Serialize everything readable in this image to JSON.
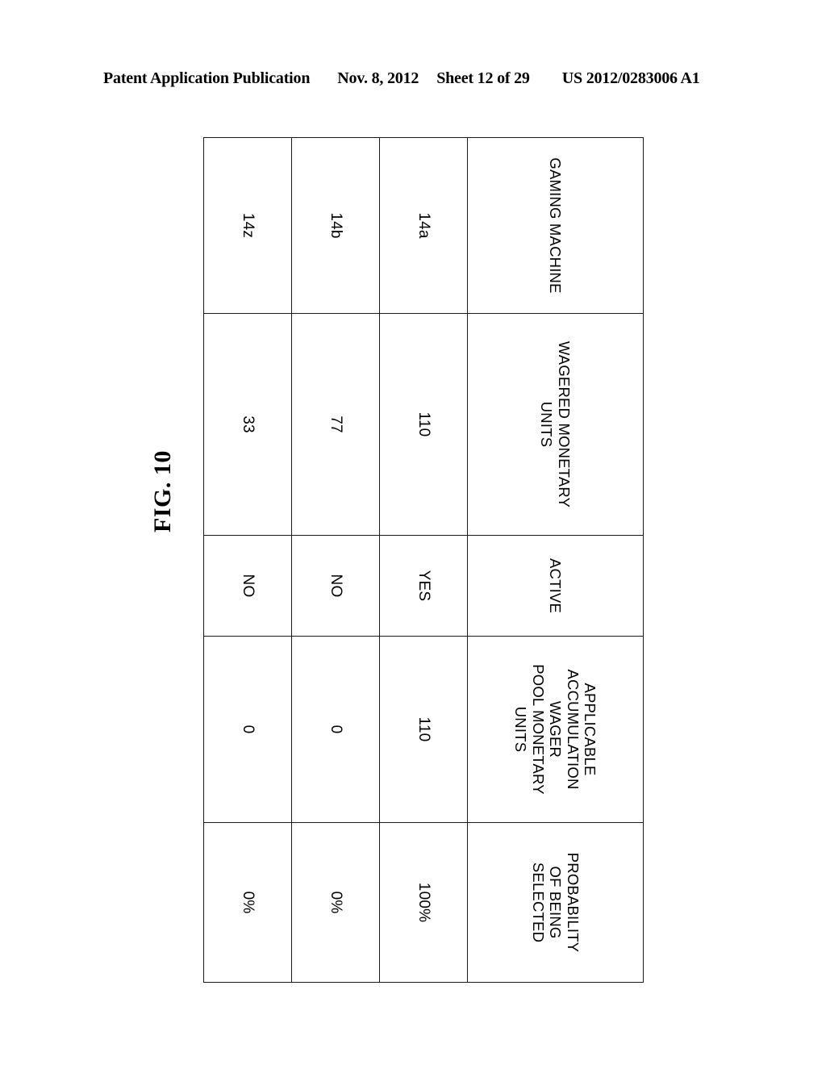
{
  "header": {
    "publication": "Patent Application Publication",
    "date": "Nov. 8, 2012",
    "sheet": "Sheet 12 of 29",
    "doc_number": "US 2012/0283006 A1"
  },
  "figure": {
    "label": "FIG. 10"
  },
  "table": {
    "columns": [
      {
        "key": "machine",
        "header_lines": [
          "GAMING MACHINE"
        ]
      },
      {
        "key": "wagered",
        "header_lines": [
          "WAGERED MONETARY",
          "UNITS"
        ]
      },
      {
        "key": "active",
        "header_lines": [
          "ACTIVE"
        ]
      },
      {
        "key": "pool",
        "header_lines": [
          "APPLICABLE",
          "ACCUMULATION",
          "WAGER",
          "POOL MONETARY",
          "UNITS"
        ]
      },
      {
        "key": "prob",
        "header_lines": [
          "PROBABILITY",
          "OF BEING",
          "SELECTED"
        ]
      }
    ],
    "rows": [
      {
        "machine": "14a",
        "wagered": "110",
        "active": "YES",
        "pool": "110",
        "prob": "100%"
      },
      {
        "machine": "14b",
        "wagered": "77",
        "active": "NO",
        "pool": "0",
        "prob": "0%"
      },
      {
        "machine": "14z",
        "wagered": "33",
        "active": "NO",
        "pool": "0",
        "prob": "0%"
      }
    ]
  },
  "colors": {
    "ink": "#1a1a1a",
    "page": "#ffffff"
  }
}
